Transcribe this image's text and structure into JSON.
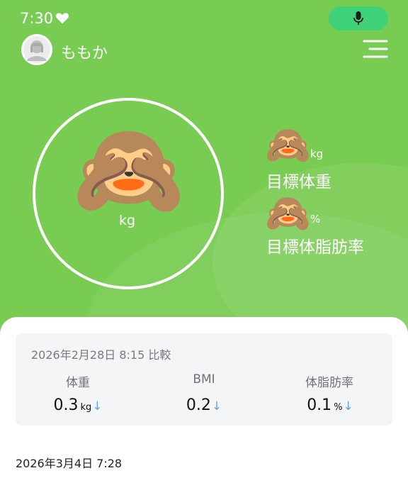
{
  "status_bar": {
    "time": "7:30"
  },
  "user": {
    "name": "ももか"
  },
  "main_display": {
    "icon": "see-no-evil-monkey",
    "emoji": "🙈",
    "unit": "kg"
  },
  "goals": [
    {
      "emoji": "🙈",
      "unit": "kg",
      "label": "目標体重"
    },
    {
      "emoji": "🙈",
      "unit": "%",
      "label": "目標体脂肪率"
    }
  ],
  "comparison": {
    "date_text": "2026年2月28日 8:15 比較",
    "metrics": [
      {
        "label": "体重",
        "value": "0.3",
        "unit": "kg",
        "trend": "down",
        "arrow": "↓"
      },
      {
        "label": "BMI",
        "value": "0.2",
        "unit": "",
        "trend": "down",
        "arrow": "↓"
      },
      {
        "label": "体脂肪率",
        "value": "0.1",
        "unit": "%",
        "trend": "down",
        "arrow": "↓"
      }
    ]
  },
  "record": {
    "date_text": "2026年3月4日 7:28"
  },
  "colors": {
    "hero_bg": "#79cc52",
    "mic_pill": "#3fd27a",
    "trend_arrow": "#5aa7e6"
  }
}
